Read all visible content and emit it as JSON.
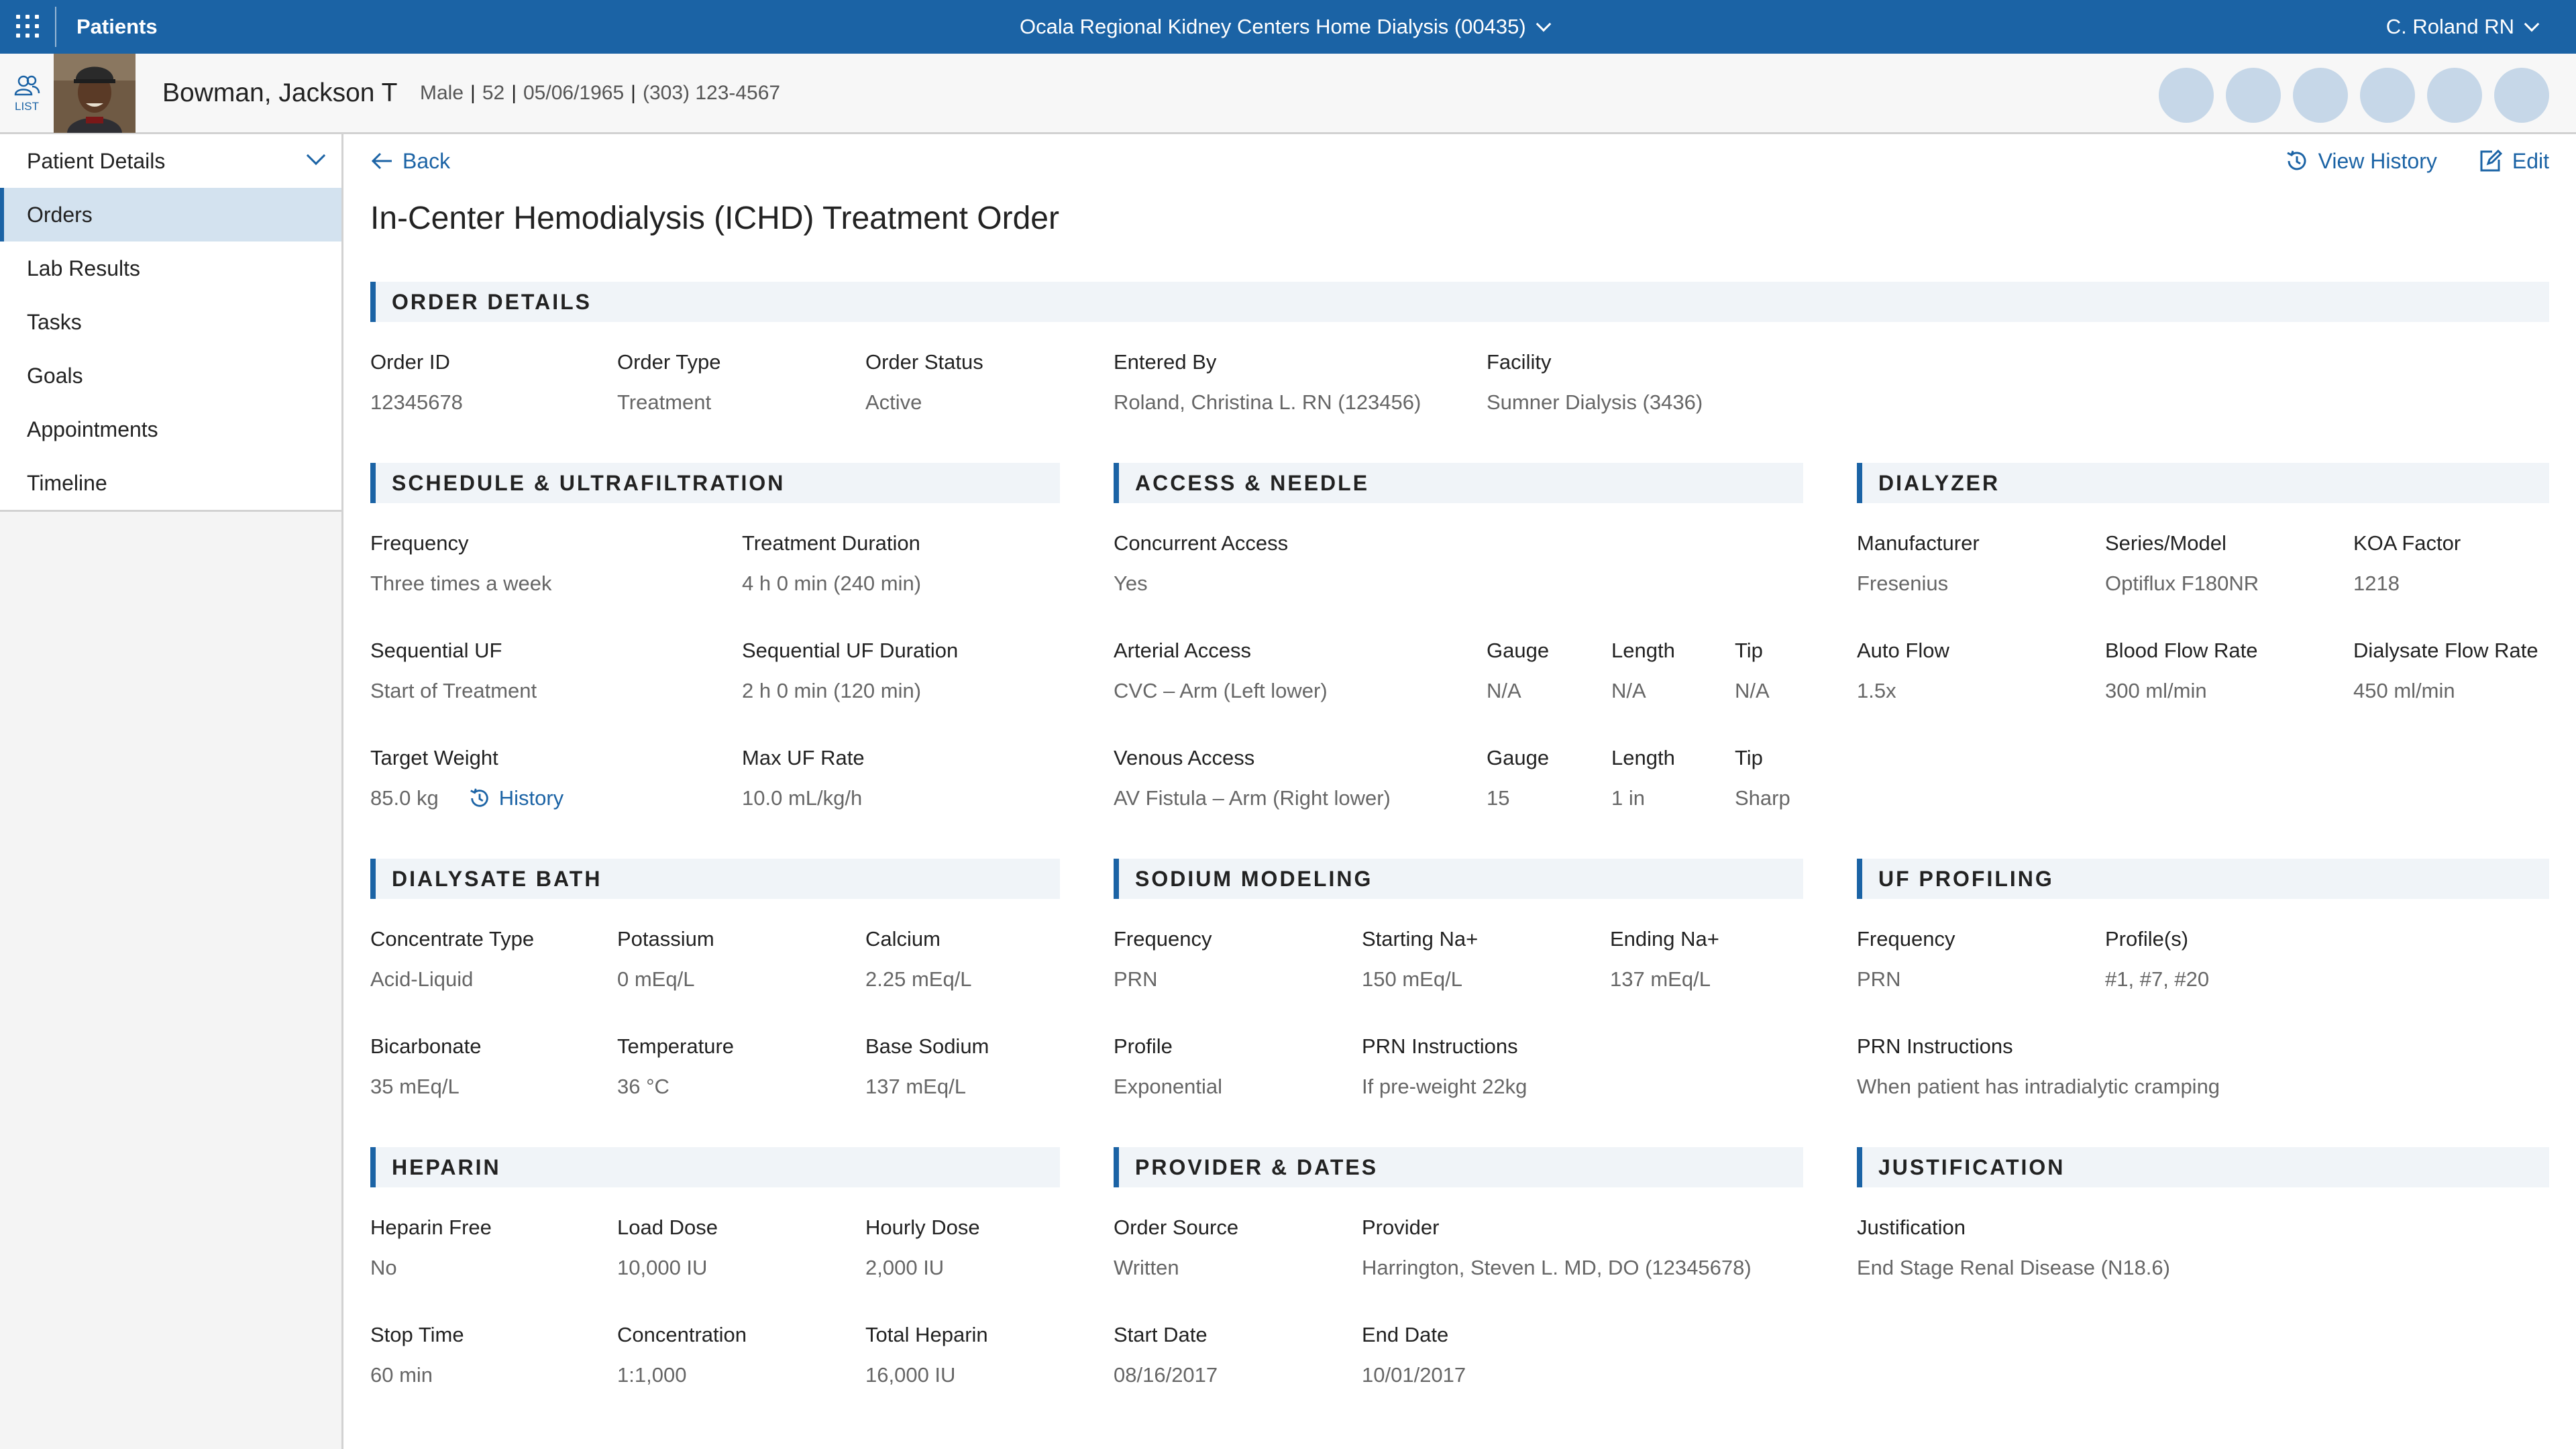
{
  "topbar": {
    "app_title": "Patients",
    "facility": "Ocala Regional Kidney Centers Home Dialysis (00435)",
    "user": "C. Roland RN"
  },
  "patient": {
    "list_label": "LIST",
    "name": "Bowman, Jackson T",
    "sex": "Male",
    "age": "52",
    "dob": "05/06/1965",
    "phone": "(303) 123-4567"
  },
  "sidebar": {
    "items": [
      {
        "label": "Patient Details"
      },
      {
        "label": "Orders"
      },
      {
        "label": "Lab Results"
      },
      {
        "label": "Tasks"
      },
      {
        "label": "Goals"
      },
      {
        "label": "Appointments"
      },
      {
        "label": "Timeline"
      }
    ]
  },
  "main": {
    "back_label": "Back",
    "view_history_label": "View History",
    "edit_label": "Edit",
    "title": "In-Center Hemodialysis (ICHD) Treatment Order"
  },
  "sections": {
    "order_details": {
      "title": "ORDER DETAILS",
      "order_id": {
        "label": "Order ID",
        "value": "12345678"
      },
      "order_type": {
        "label": "Order Type",
        "value": "Treatment"
      },
      "order_status": {
        "label": "Order Status",
        "value": "Active"
      },
      "entered_by": {
        "label": "Entered By",
        "value": "Roland, Christina L. RN (123456)"
      },
      "facility": {
        "label": "Facility",
        "value": "Sumner Dialysis (3436)"
      }
    },
    "schedule": {
      "title": "SCHEDULE & ULTRAFILTRATION",
      "frequency": {
        "label": "Frequency",
        "value": "Three times a week"
      },
      "duration": {
        "label": "Treatment Duration",
        "value": "4 h 0 min (240 min)"
      },
      "seq_uf": {
        "label": "Sequential UF",
        "value": "Start of Treatment"
      },
      "seq_uf_duration": {
        "label": "Sequential UF Duration",
        "value": "2 h 0 min (120 min)"
      },
      "target_weight": {
        "label": "Target Weight",
        "value": "85.0 kg",
        "history_label": "History"
      },
      "max_uf": {
        "label": "Max UF Rate",
        "value": "10.0 mL/kg/h"
      }
    },
    "access": {
      "title": "ACCESS & NEEDLE",
      "concurrent": {
        "label": "Concurrent Access",
        "value": "Yes"
      },
      "arterial": {
        "label": "Arterial Access",
        "value": "CVC – Arm (Left lower)"
      },
      "art_gauge": {
        "label": "Gauge",
        "value": "N/A"
      },
      "art_length": {
        "label": "Length",
        "value": "N/A"
      },
      "art_tip": {
        "label": "Tip",
        "value": "N/A"
      },
      "venous": {
        "label": "Venous Access",
        "value": "AV Fistula – Arm (Right lower)"
      },
      "ven_gauge": {
        "label": "Gauge",
        "value": "15"
      },
      "ven_length": {
        "label": "Length",
        "value": "1 in"
      },
      "ven_tip": {
        "label": "Tip",
        "value": "Sharp"
      }
    },
    "dialyzer": {
      "title": "DIALYZER",
      "manufacturer": {
        "label": "Manufacturer",
        "value": "Fresenius"
      },
      "series": {
        "label": "Series/Model",
        "value": "Optiflux F180NR"
      },
      "koa": {
        "label": "KOA Factor",
        "value": "1218"
      },
      "auto_flow": {
        "label": "Auto Flow",
        "value": "1.5x"
      },
      "blood_flow": {
        "label": "Blood Flow Rate",
        "value": "300 ml/min"
      },
      "dialysate_flow": {
        "label": "Dialysate Flow Rate",
        "value": "450 ml/min"
      }
    },
    "bath": {
      "title": "DIALYSATE BATH",
      "concentrate": {
        "label": "Concentrate Type",
        "value": "Acid-Liquid"
      },
      "potassium": {
        "label": "Potassium",
        "value": "0 mEq/L"
      },
      "calcium": {
        "label": "Calcium",
        "value": "2.25 mEq/L"
      },
      "bicarbonate": {
        "label": "Bicarbonate",
        "value": "35 mEq/L"
      },
      "temperature": {
        "label": "Temperature",
        "value": "36 °C"
      },
      "base_sodium": {
        "label": "Base Sodium",
        "value": "137 mEq/L"
      }
    },
    "sodium": {
      "title": "SODIUM MODELING",
      "frequency": {
        "label": "Frequency",
        "value": "PRN"
      },
      "starting": {
        "label": "Starting Na+",
        "value": "150 mEq/L"
      },
      "ending": {
        "label": "Ending Na+",
        "value": "137 mEq/L"
      },
      "profile": {
        "label": "Profile",
        "value": "Exponential"
      },
      "prn": {
        "label": "PRN Instructions",
        "value": "If pre-weight 22kg"
      }
    },
    "uf_profiling": {
      "title": "UF PROFILING",
      "frequency": {
        "label": "Frequency",
        "value": "PRN"
      },
      "profiles": {
        "label": "Profile(s)",
        "value": "#1, #7, #20"
      },
      "prn": {
        "label": "PRN Instructions",
        "value": "When patient has intradialytic cramping"
      }
    },
    "heparin": {
      "title": "HEPARIN",
      "free": {
        "label": "Heparin Free",
        "value": "No"
      },
      "load": {
        "label": "Load Dose",
        "value": "10,000 IU"
      },
      "hourly": {
        "label": "Hourly Dose",
        "value": "2,000 IU"
      },
      "stop": {
        "label": "Stop Time",
        "value": "60 min"
      },
      "concentration": {
        "label": "Concentration",
        "value": "1:1,000"
      },
      "total": {
        "label": "Total Heparin",
        "value": "16,000 IU"
      }
    },
    "provider": {
      "title": "PROVIDER & DATES",
      "source": {
        "label": "Order Source",
        "value": "Written"
      },
      "provider": {
        "label": "Provider",
        "value": "Harrington, Steven L. MD, DO (12345678)"
      },
      "start": {
        "label": "Start Date",
        "value": "08/16/2017"
      },
      "end": {
        "label": "End Date",
        "value": "10/01/2017"
      }
    },
    "justification": {
      "title": "JUSTIFICATION",
      "justification": {
        "label": "Justification",
        "value": "End Stage Renal Disease (N18.6)"
      }
    }
  },
  "colors": {
    "brand": "#1b63a5",
    "nav_active": "#d3e2ef",
    "avatar_placeholder": "#c6d7e8"
  }
}
